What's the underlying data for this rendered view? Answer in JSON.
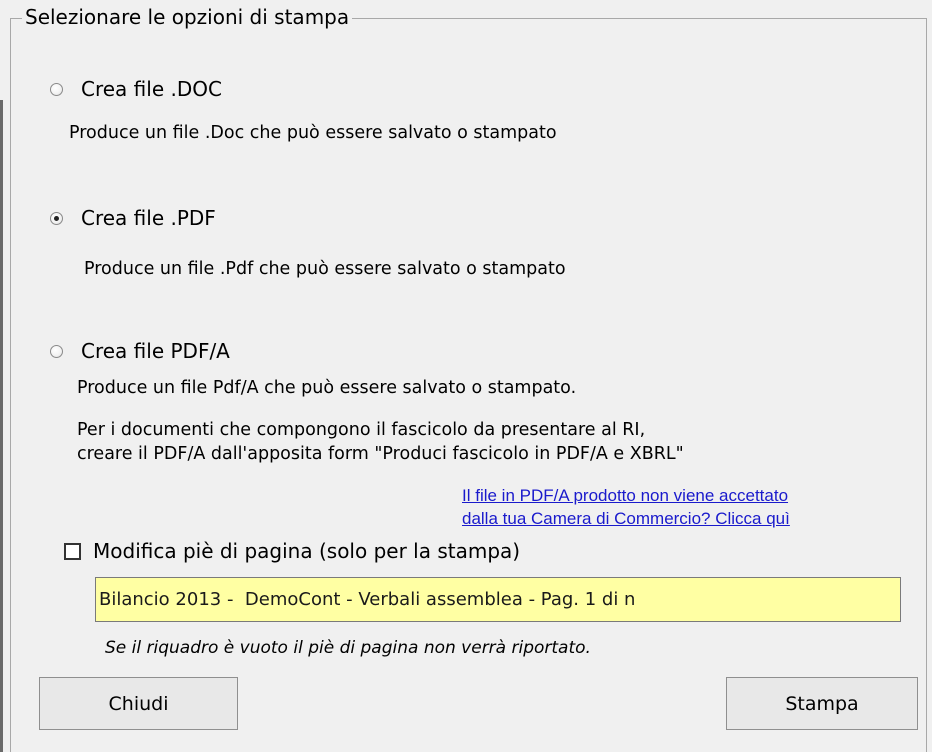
{
  "frame": {
    "caption": "Selezionare le opzioni di stampa"
  },
  "options": [
    {
      "label": "Crea file .DOC",
      "checked": false,
      "description": "Produce un file .Doc che può essere salvato o stampato"
    },
    {
      "label": "Crea file .PDF",
      "checked": true,
      "description": "Produce un file .Pdf che può essere salvato o stampato"
    },
    {
      "label": "Crea file PDF/A",
      "checked": false,
      "description": "Produce un file Pdf/A che può essere salvato o stampato.",
      "note_line1": "Per i documenti che compongono il fascicolo da presentare al RI,",
      "note_line2": "creare il PDF/A dall'apposita form \"Produci fascicolo in PDF/A e XBRL\""
    }
  ],
  "help_link": {
    "line1": "Il file in PDF/A prodotto non viene accettato",
    "line2": "dalla tua Camera di Commercio? Clicca quì"
  },
  "footer": {
    "checkbox_label": "Modifica piè di pagina (solo per la stampa)",
    "checked": false,
    "value": "Bilancio 2013 -  DemoCont - Verbali assemblea - Pag. 1 di n",
    "hint": "Se il riquadro è vuoto il piè di pagina non verrà riportato."
  },
  "buttons": {
    "close": "Chiudi",
    "print": "Stampa"
  },
  "colors": {
    "background": "#f0f0f0",
    "input_background": "#ffffa3",
    "link": "#1a1acc"
  }
}
